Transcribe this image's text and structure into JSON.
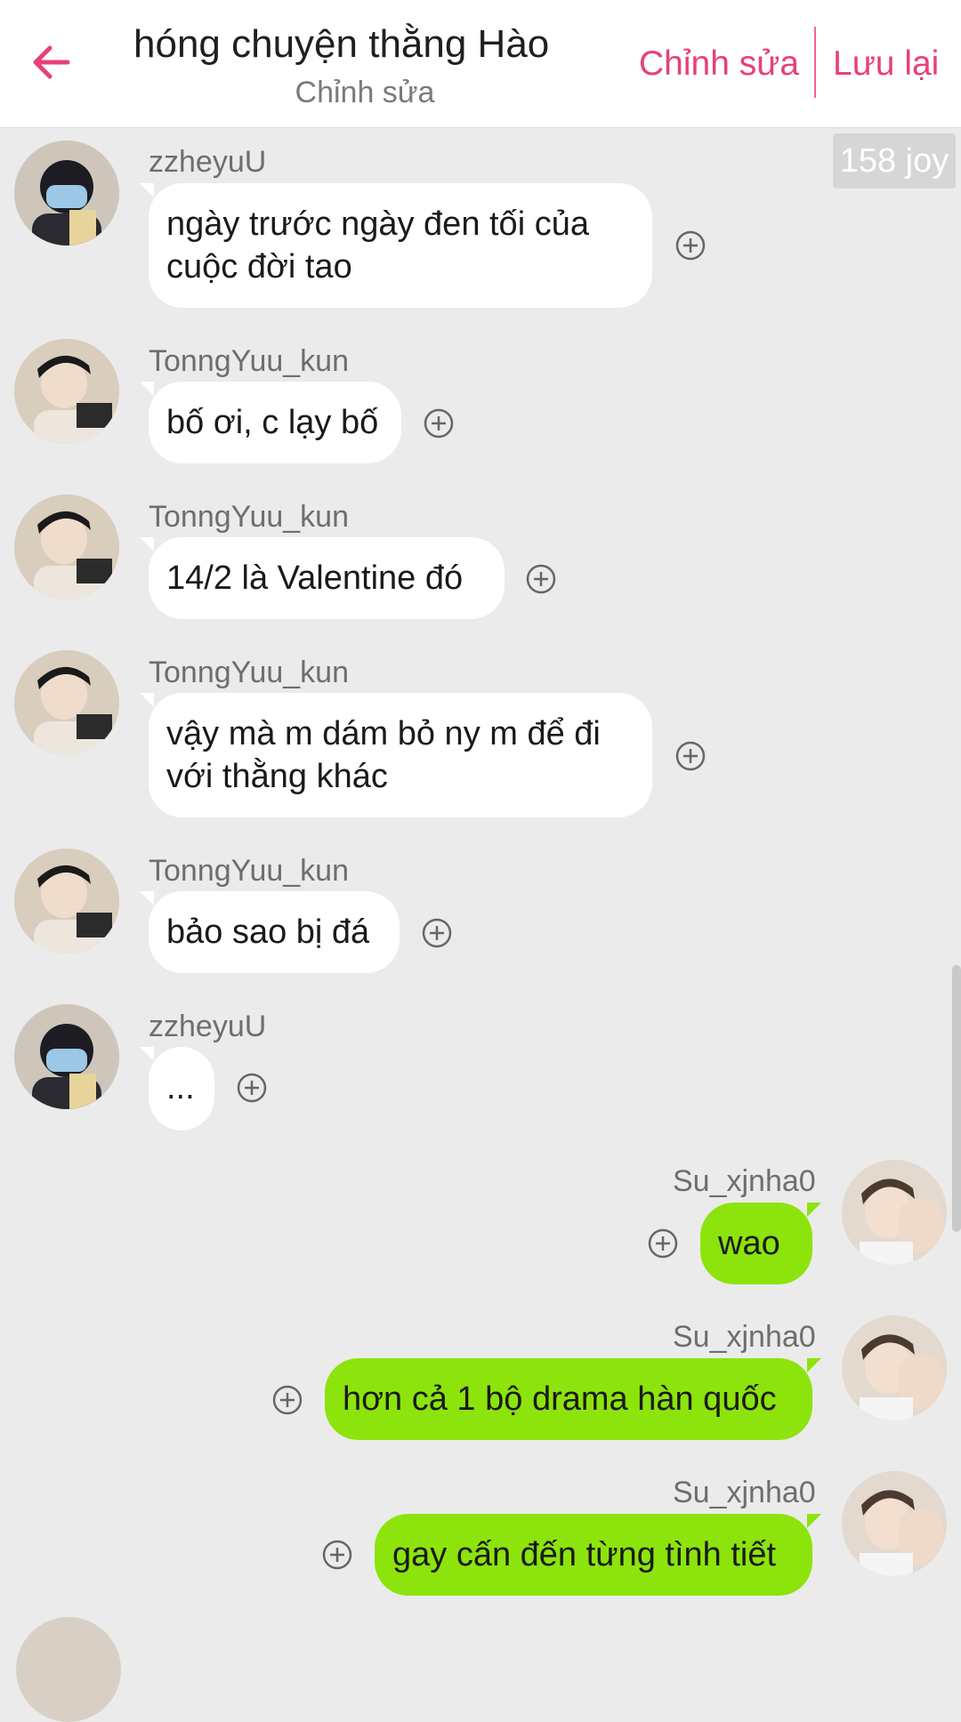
{
  "header": {
    "title": "hóng chuyện thằng Hào",
    "subtitle": "Chỉnh sửa",
    "edit_label": "Chỉnh sửa",
    "save_label": "Lưu lại"
  },
  "joy_badge": "158 joy",
  "colors": {
    "accent": "#e8407a",
    "bubble_left": "#ffffff",
    "bubble_right": "#8ce40c",
    "background": "#ebebeb"
  },
  "messages": [
    {
      "user": "zzheyuU",
      "text": "ngày trước ngày đen tối của cuộc đời tao",
      "side": "left"
    },
    {
      "user": "TonngYuu_kun",
      "text": "bố ơi, c lạy bố",
      "side": "left"
    },
    {
      "user": "TonngYuu_kun",
      "text": "14/2 là Valentine đó",
      "side": "left"
    },
    {
      "user": "TonngYuu_kun",
      "text": "vậy mà m dám bỏ ny m để đi với thằng khác",
      "side": "left"
    },
    {
      "user": "TonngYuu_kun",
      "text": "bảo sao bị đá",
      "side": "left"
    },
    {
      "user": "zzheyuU",
      "text": "...",
      "side": "left"
    },
    {
      "user": "Su_xjnha0",
      "text": "wao",
      "side": "right"
    },
    {
      "user": "Su_xjnha0",
      "text": "hơn cả 1 bộ drama hàn quốc",
      "side": "right"
    },
    {
      "user": "Su_xjnha0",
      "text": "gay cấn đến từng tình tiết",
      "side": "right"
    }
  ]
}
